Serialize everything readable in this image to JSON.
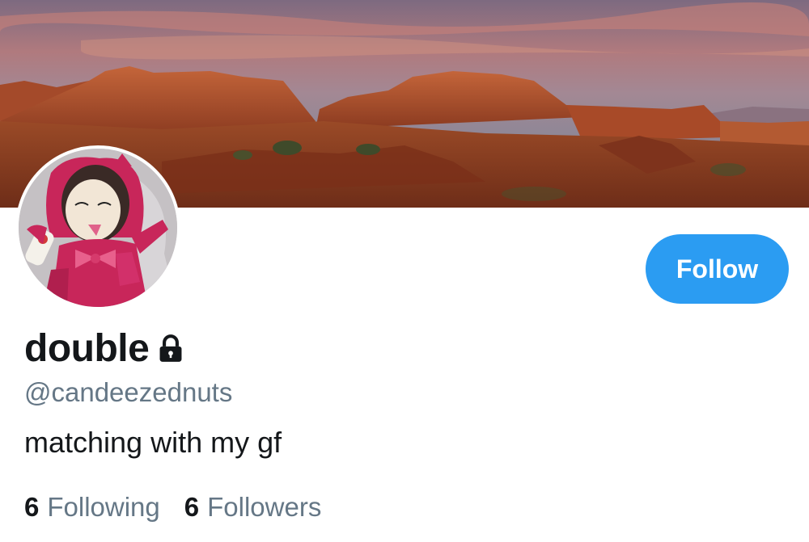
{
  "profile": {
    "display_name": "double",
    "handle": "@candeezednuts",
    "bio": "matching with my gf",
    "protected_icon": "lock-icon"
  },
  "actions": {
    "follow_label": "Follow"
  },
  "stats": {
    "following_count": "6",
    "following_label": "Following",
    "followers_count": "6",
    "followers_label": "Followers"
  },
  "colors": {
    "accent": "#2b9cf2",
    "text_primary": "#14171a",
    "text_secondary": "#657786"
  }
}
